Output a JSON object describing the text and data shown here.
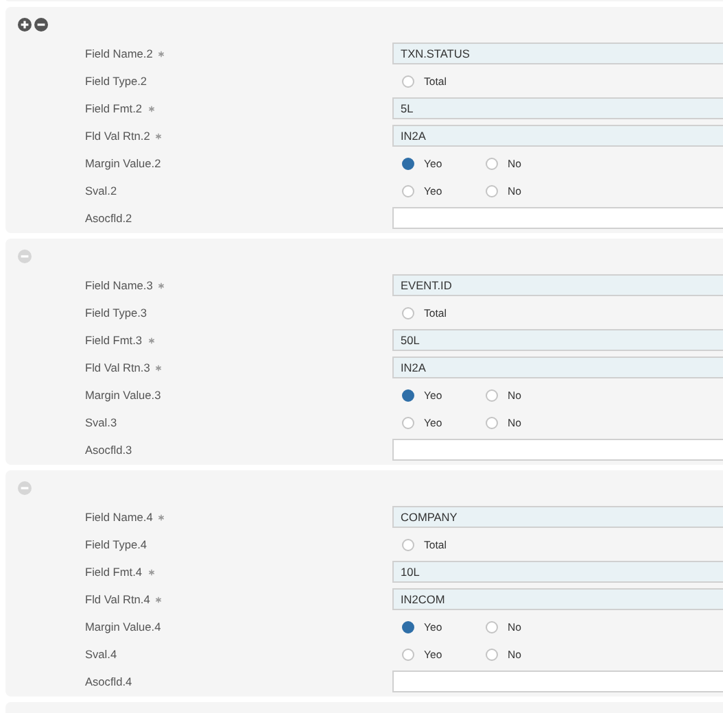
{
  "panels": [
    {
      "buttons": [
        {
          "kind": "add",
          "disabled": false
        },
        {
          "kind": "remove",
          "disabled": false
        }
      ],
      "rows": [
        {
          "kind": "text",
          "label": "Field Name.2",
          "required": true,
          "value": "TXN.STATUS"
        },
        {
          "kind": "radio",
          "label": "Field Type.2",
          "required": false,
          "options": [
            {
              "label": "Total",
              "selected": false
            }
          ]
        },
        {
          "kind": "text",
          "label": "Field Fmt.2",
          "required": true,
          "value": "5L"
        },
        {
          "kind": "text",
          "label": "Fld Val Rtn.2",
          "required": true,
          "value": "IN2A"
        },
        {
          "kind": "radio",
          "label": "Margin Value.2",
          "required": false,
          "options": [
            {
              "label": "Yeo",
              "selected": true
            },
            {
              "label": "No",
              "selected": false
            }
          ]
        },
        {
          "kind": "radio",
          "label": "Sval.2",
          "required": false,
          "options": [
            {
              "label": "Yeo",
              "selected": false
            },
            {
              "label": "No",
              "selected": false
            }
          ]
        },
        {
          "kind": "input",
          "label": "Asocfld.2",
          "required": false
        }
      ]
    },
    {
      "buttons": [
        {
          "kind": "remove",
          "disabled": true
        }
      ],
      "rows": [
        {
          "kind": "text",
          "label": "Field Name.3",
          "required": true,
          "value": "EVENT.ID"
        },
        {
          "kind": "radio",
          "label": "Field Type.3",
          "required": false,
          "options": [
            {
              "label": "Total",
              "selected": false
            }
          ]
        },
        {
          "kind": "text",
          "label": "Field Fmt.3",
          "required": true,
          "value": "50L"
        },
        {
          "kind": "text",
          "label": "Fld Val Rtn.3",
          "required": true,
          "value": "IN2A"
        },
        {
          "kind": "radio",
          "label": "Margin Value.3",
          "required": false,
          "options": [
            {
              "label": "Yeo",
              "selected": true
            },
            {
              "label": "No",
              "selected": false
            }
          ]
        },
        {
          "kind": "radio",
          "label": "Sval.3",
          "required": false,
          "options": [
            {
              "label": "Yeo",
              "selected": false
            },
            {
              "label": "No",
              "selected": false
            }
          ]
        },
        {
          "kind": "input",
          "label": "Asocfld.3",
          "required": false
        }
      ]
    },
    {
      "buttons": [
        {
          "kind": "remove",
          "disabled": true
        }
      ],
      "rows": [
        {
          "kind": "text",
          "label": "Field Name.4",
          "required": true,
          "value": "COMPANY"
        },
        {
          "kind": "radio",
          "label": "Field Type.4",
          "required": false,
          "options": [
            {
              "label": "Total",
              "selected": false
            }
          ]
        },
        {
          "kind": "text",
          "label": "Field Fmt.4",
          "required": true,
          "value": "10L"
        },
        {
          "kind": "text",
          "label": "Fld Val Rtn.4",
          "required": true,
          "value": "IN2COM"
        },
        {
          "kind": "radio",
          "label": "Margin Value.4",
          "required": false,
          "options": [
            {
              "label": "Yeo",
              "selected": true
            },
            {
              "label": "No",
              "selected": false
            }
          ]
        },
        {
          "kind": "radio",
          "label": "Sval.4",
          "required": false,
          "options": [
            {
              "label": "Yeo",
              "selected": false
            },
            {
              "label": "No",
              "selected": false
            }
          ]
        },
        {
          "kind": "input",
          "label": "Asocfld.4",
          "required": false
        }
      ]
    }
  ]
}
